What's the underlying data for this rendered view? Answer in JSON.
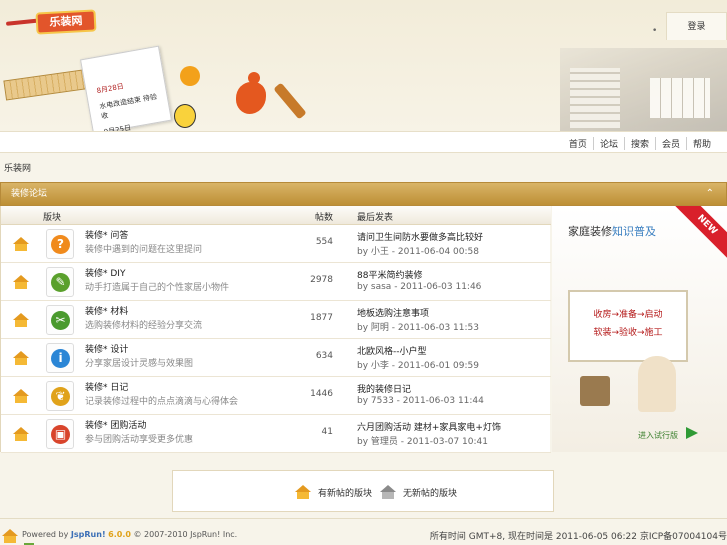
{
  "header": {
    "logo_text": "乐装网",
    "note_line1": "8月28日",
    "note_line2": "水电改造结束 待验收",
    "note_line3": "9月25日",
    "login_tab": "登录",
    "nav_links": [
      "首页",
      "论坛",
      "搜索",
      "会员",
      "帮助"
    ]
  },
  "breadcrumb": "乐装网",
  "forum_group": {
    "title": "装修论坛",
    "collapse_icon": "chevron-up-icon",
    "headers": {
      "forum": "版块",
      "posts": "帖数",
      "last_post": "最后发表"
    },
    "forums": [
      {
        "name": "装修* 问答",
        "desc": "装修中遇到的问题在这里提问",
        "count": "554",
        "last_title": "请问卫生间防水要做多高比较好",
        "last_by": "by ",
        "last_author": "小王",
        "last_time": " - 2011-06-04 00:58",
        "icon": "question-icon",
        "icon_color": "#f08a1c"
      },
      {
        "name": "装修* DIY",
        "desc": "动手打造属于自己的个性家居小物件",
        "count": "2978",
        "last_title": "88平米简约装修",
        "last_by": "by ",
        "last_author": "sasa",
        "last_time": " - 2011-06-03 11:46",
        "icon": "pencil-icon",
        "icon_color": "#5aa02c"
      },
      {
        "name": "装修* 材料",
        "desc": "选购装修材料的经验分享交流",
        "count": "1877",
        "last_title": "地板选购注意事项",
        "last_by": "by ",
        "last_author": "阿明",
        "last_time": " - 2011-06-03 11:53",
        "icon": "scissors-icon",
        "icon_color": "#4a9a2e"
      },
      {
        "name": "装修* 设计",
        "desc": "分享家居设计灵感与效果图",
        "count": "634",
        "last_title": "北欧风格--小户型",
        "last_by": "by ",
        "last_author": "小李",
        "last_time": " - 2011-06-01 09:59",
        "icon": "info-icon",
        "icon_color": "#2b86d6"
      },
      {
        "name": "装修* 日记",
        "desc": "记录装修过程中的点点滴滴与心得体会",
        "count": "1446",
        "last_title": "我的装修日记",
        "last_by": "by ",
        "last_author": "7533",
        "last_time": " - 2011-06-03 11:44",
        "icon": "plant-icon",
        "icon_color": "#e0a21a"
      },
      {
        "name": "装修* 团购活动",
        "desc": "参与团购活动享受更多优惠",
        "count": "41",
        "last_title": "六月团购活动 建材+家具家电+灯饰",
        "last_by": "by ",
        "last_author": "管理员",
        "last_time": " - 2011-03-07 10:41",
        "icon": "gift-icon",
        "icon_color": "#d8442b"
      }
    ]
  },
  "ad": {
    "title_prefix": "家庭装修",
    "title_highlight": "知识普及",
    "ribbon": "NEW",
    "board_line1": "收房→准备→启动",
    "board_line2": "软装→验收→施工",
    "enter_text": "进入试行版"
  },
  "legend": {
    "new_label": "有新帖的版块",
    "no_new_label": "无新帖的版块"
  },
  "footer": {
    "powered_prefix": "Powered by ",
    "powered_brand": "JspRun!",
    "powered_version": "6.0.0",
    "copyright": "© 2007-2010 JspRun! Inc.",
    "right_text": "所有时间 GMT+8, 现在时间是 2011-06-05 06:22 京ICP备07004104号"
  },
  "colors": {
    "header_gold": "#c99d48",
    "accent_orange": "#e49a1f",
    "brand_blue": "#3b6fb6"
  }
}
